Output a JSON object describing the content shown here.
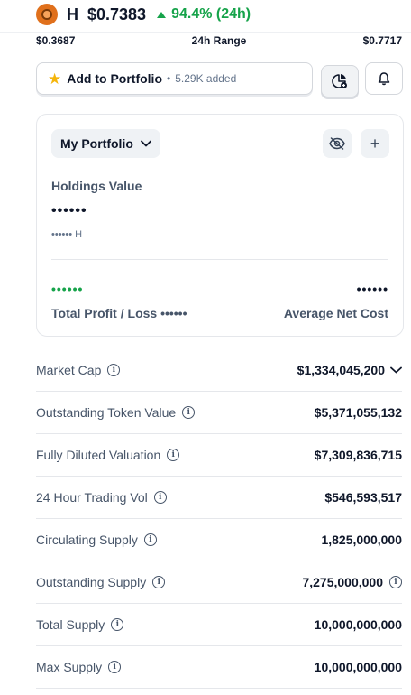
{
  "header": {
    "ticker": "H",
    "price": "$0.7383",
    "change": "94.4% (24h)",
    "accent_green": "#16a34a"
  },
  "range": {
    "low": "$0.3687",
    "label": "24h Range",
    "high": "$0.7717"
  },
  "portfolio_button": {
    "label": "Add to Portfolio",
    "count": "5.29K added",
    "icon": "star-icon"
  },
  "card": {
    "dropdown_label": "My Portfolio",
    "holdings_label": "Holdings Value",
    "holdings_value": "••••••",
    "holdings_sub": "•••••• H",
    "pl_value": "••••••",
    "pl_label": "Total Profit / Loss ••••••",
    "anc_value": "••••••",
    "anc_label": "Average Net Cost",
    "plus": "+"
  },
  "stats": [
    {
      "label": "Market Cap",
      "value": "$1,334,045,200"
    },
    {
      "label": "Outstanding Token Value",
      "value": "$5,371,055,132"
    },
    {
      "label": "Fully Diluted Valuation",
      "value": "$7,309,836,715"
    },
    {
      "label": "24 Hour Trading Vol",
      "value": "$546,593,517"
    },
    {
      "label": "Circulating Supply",
      "value": "1,825,000,000"
    },
    {
      "label": "Outstanding Supply",
      "value": "7,275,000,000"
    },
    {
      "label": "Total Supply",
      "value": "10,000,000,000"
    },
    {
      "label": "Max Supply",
      "value": "10,000,000,000"
    }
  ]
}
